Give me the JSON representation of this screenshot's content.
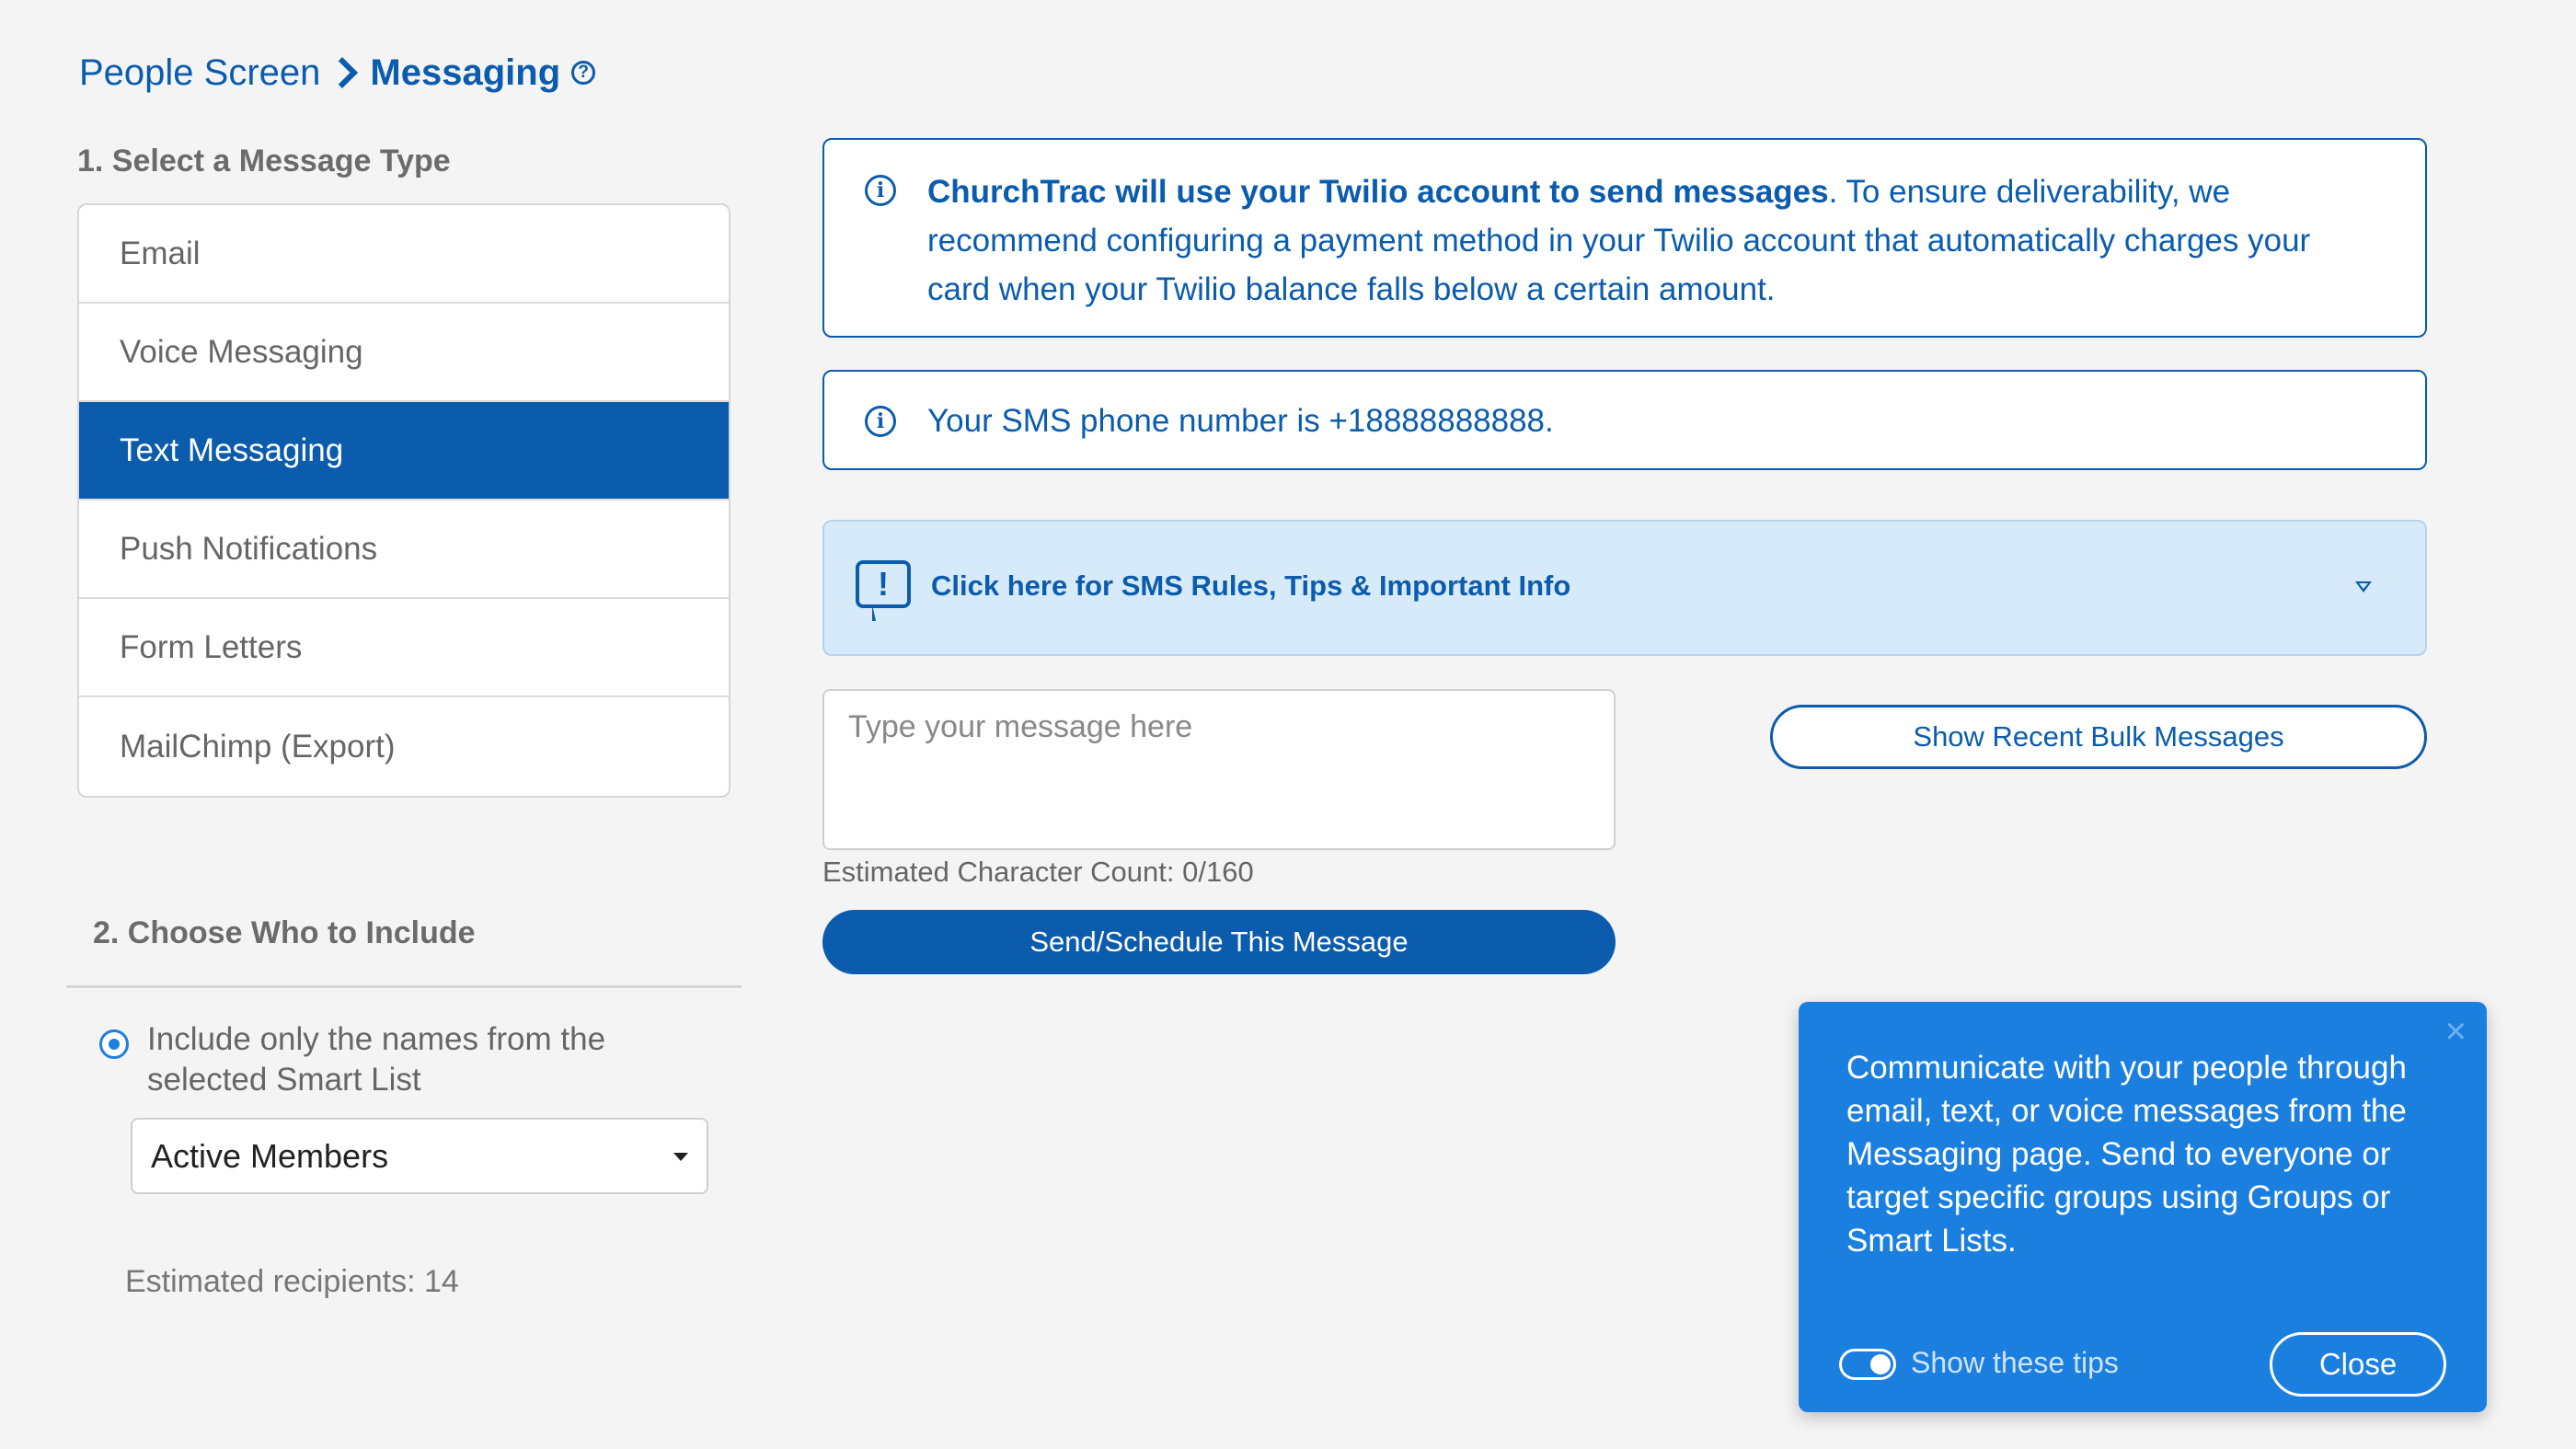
{
  "breadcrumb": {
    "parent": "People Screen",
    "current": "Messaging",
    "help_icon": "?"
  },
  "section1": {
    "label": "1. Select a Message Type",
    "types": [
      {
        "label": "Email",
        "active": false
      },
      {
        "label": "Voice Messaging",
        "active": false
      },
      {
        "label": "Text Messaging",
        "active": true
      },
      {
        "label": "Push Notifications",
        "active": false
      },
      {
        "label": "Form Letters",
        "active": false
      },
      {
        "label": "MailChimp (Export)",
        "active": false
      }
    ]
  },
  "section2": {
    "label": "2. Choose Who to Include",
    "radio_label": "Include only the names from the selected Smart List",
    "smart_list_value": "Active Members",
    "recipients": "Estimated recipients: 14"
  },
  "info_twilio": {
    "icon": "i",
    "bold": "ChurchTrac will use your Twilio account to send messages",
    "rest": ". To ensure deliverability, we recommend configuring a payment method in your Twilio account that automatically charges your card when your Twilio balance falls below a certain amount."
  },
  "info_phone": {
    "icon": "i",
    "text": "Your SMS phone number is +18888888888."
  },
  "tips_bar": {
    "icon": "!",
    "text": "Click here for SMS Rules, Tips & Important Info"
  },
  "composer": {
    "placeholder": "Type your message here",
    "value": "",
    "char_count": "Estimated Character Count: 0/160",
    "send_label": "Send/Schedule This Message",
    "recent_label": "Show Recent Bulk Messages"
  },
  "popup": {
    "close_x": "×",
    "text": "Communicate with your people through email, text, or voice messages from the Messaging page. Send to everyone or target specific groups using Groups or Smart Lists.",
    "toggle_label": "Show these tips",
    "toggle_on": true,
    "close_label": "Close"
  },
  "colors": {
    "primary": "#0b5cad",
    "popup": "#1b7fe0",
    "tips_bg": "#d7eaf9",
    "page_bg": "#f4f4f4"
  }
}
